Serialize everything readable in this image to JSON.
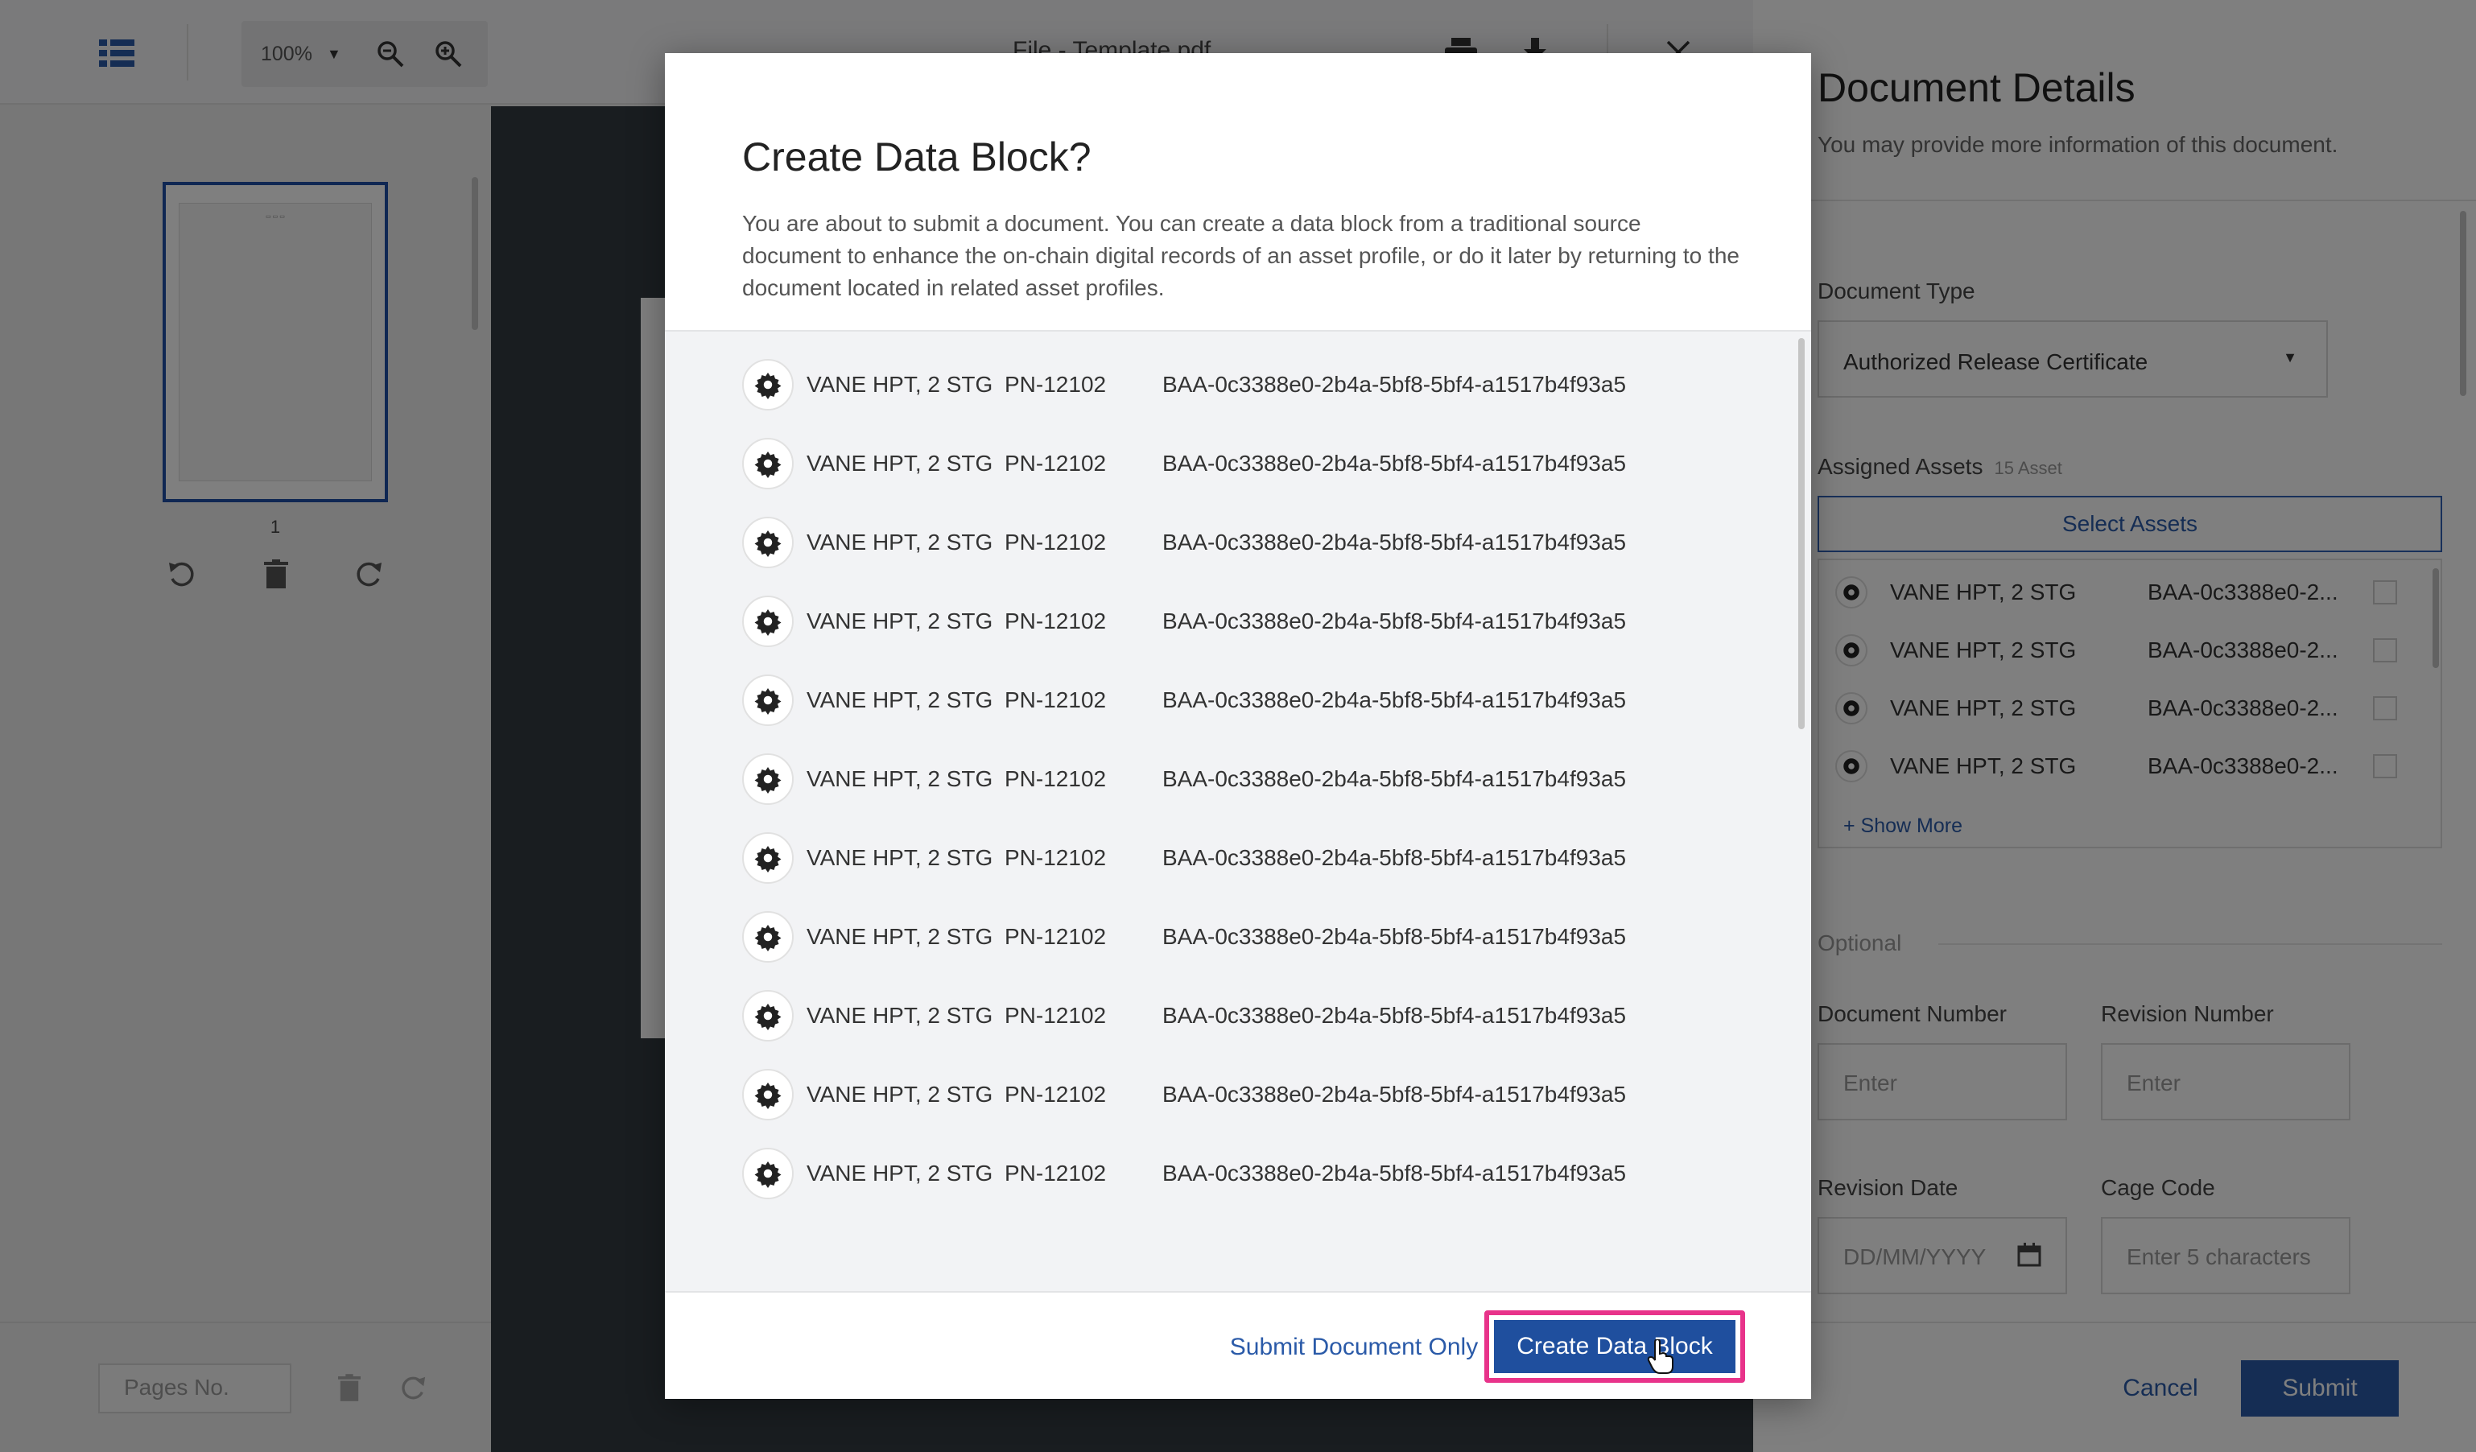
{
  "toolbar": {
    "zoom_value": "100%",
    "file_title": "File - Template.pdf"
  },
  "thumbnails": {
    "page_number": "1",
    "pages_placeholder": "Pages No."
  },
  "details": {
    "title": "Document Details",
    "subtitle": "You may provide more information of this document.",
    "document_type_label": "Document Type",
    "document_type_value": "Authorized Release Certificate",
    "assigned_assets_label": "Assigned Assets",
    "assigned_assets_count": "15 Asset",
    "select_assets_label": "Select Assets",
    "assets": [
      {
        "name": "VANE HPT, 2 STG",
        "id": "BAA-0c3388e0-2..."
      },
      {
        "name": "VANE HPT, 2 STG",
        "id": "BAA-0c3388e0-2..."
      },
      {
        "name": "VANE HPT, 2 STG",
        "id": "BAA-0c3388e0-2..."
      },
      {
        "name": "VANE HPT, 2 STG",
        "id": "BAA-0c3388e0-2..."
      }
    ],
    "show_more_label": "Show More",
    "optional_label": "Optional",
    "document_number_label": "Document Number",
    "document_number_placeholder": "Enter",
    "revision_number_label": "Revision Number",
    "revision_number_placeholder": "Enter",
    "revision_date_label": "Revision Date",
    "revision_date_placeholder": "DD/MM/YYYY",
    "cage_code_label": "Cage Code",
    "cage_code_placeholder": "Enter 5 characters",
    "cancel_label": "Cancel",
    "submit_label": "Submit"
  },
  "modal": {
    "title": "Create Data Block?",
    "description": "You are about to submit a document. You can create a data block from a traditional source document to enhance the on-chain digital records of an asset profile, or do it later by returning to the document located in related asset profiles.",
    "rows": [
      {
        "name": "VANE HPT, 2 STG",
        "pn": "PN-12102",
        "block_id": "BAA-0c3388e0-2b4a-5bf8-5bf4-a1517b4f93a5"
      },
      {
        "name": "VANE HPT, 2 STG",
        "pn": "PN-12102",
        "block_id": "BAA-0c3388e0-2b4a-5bf8-5bf4-a1517b4f93a5"
      },
      {
        "name": "VANE HPT, 2 STG",
        "pn": "PN-12102",
        "block_id": "BAA-0c3388e0-2b4a-5bf8-5bf4-a1517b4f93a5"
      },
      {
        "name": "VANE HPT, 2 STG",
        "pn": "PN-12102",
        "block_id": "BAA-0c3388e0-2b4a-5bf8-5bf4-a1517b4f93a5"
      },
      {
        "name": "VANE HPT, 2 STG",
        "pn": "PN-12102",
        "block_id": "BAA-0c3388e0-2b4a-5bf8-5bf4-a1517b4f93a5"
      },
      {
        "name": "VANE HPT, 2 STG",
        "pn": "PN-12102",
        "block_id": "BAA-0c3388e0-2b4a-5bf8-5bf4-a1517b4f93a5"
      },
      {
        "name": "VANE HPT, 2 STG",
        "pn": "PN-12102",
        "block_id": "BAA-0c3388e0-2b4a-5bf8-5bf4-a1517b4f93a5"
      },
      {
        "name": "VANE HPT, 2 STG",
        "pn": "PN-12102",
        "block_id": "BAA-0c3388e0-2b4a-5bf8-5bf4-a1517b4f93a5"
      },
      {
        "name": "VANE HPT, 2 STG",
        "pn": "PN-12102",
        "block_id": "BAA-0c3388e0-2b4a-5bf8-5bf4-a1517b4f93a5"
      },
      {
        "name": "VANE HPT, 2 STG",
        "pn": "PN-12102",
        "block_id": "BAA-0c3388e0-2b4a-5bf8-5bf4-a1517b4f93a5"
      },
      {
        "name": "VANE HPT, 2 STG",
        "pn": "PN-12102",
        "block_id": "BAA-0c3388e0-2b4a-5bf8-5bf4-a1517b4f93a5"
      }
    ],
    "secondary_action": "Submit Document Only",
    "primary_action": "Create Data Block"
  },
  "colors": {
    "accent": "#1f4f9e",
    "link": "#2a5aa8",
    "highlight_ring": "#e8338a"
  },
  "icons": [
    "list-view-icon",
    "chevron-down-icon",
    "zoom-out-icon",
    "zoom-in-icon",
    "print-icon",
    "download-icon",
    "close-icon",
    "rotate-left-icon",
    "trash-icon",
    "rotate-right-icon",
    "asset-gear-icon",
    "plus-icon",
    "calendar-icon",
    "cursor-hand-icon"
  ]
}
